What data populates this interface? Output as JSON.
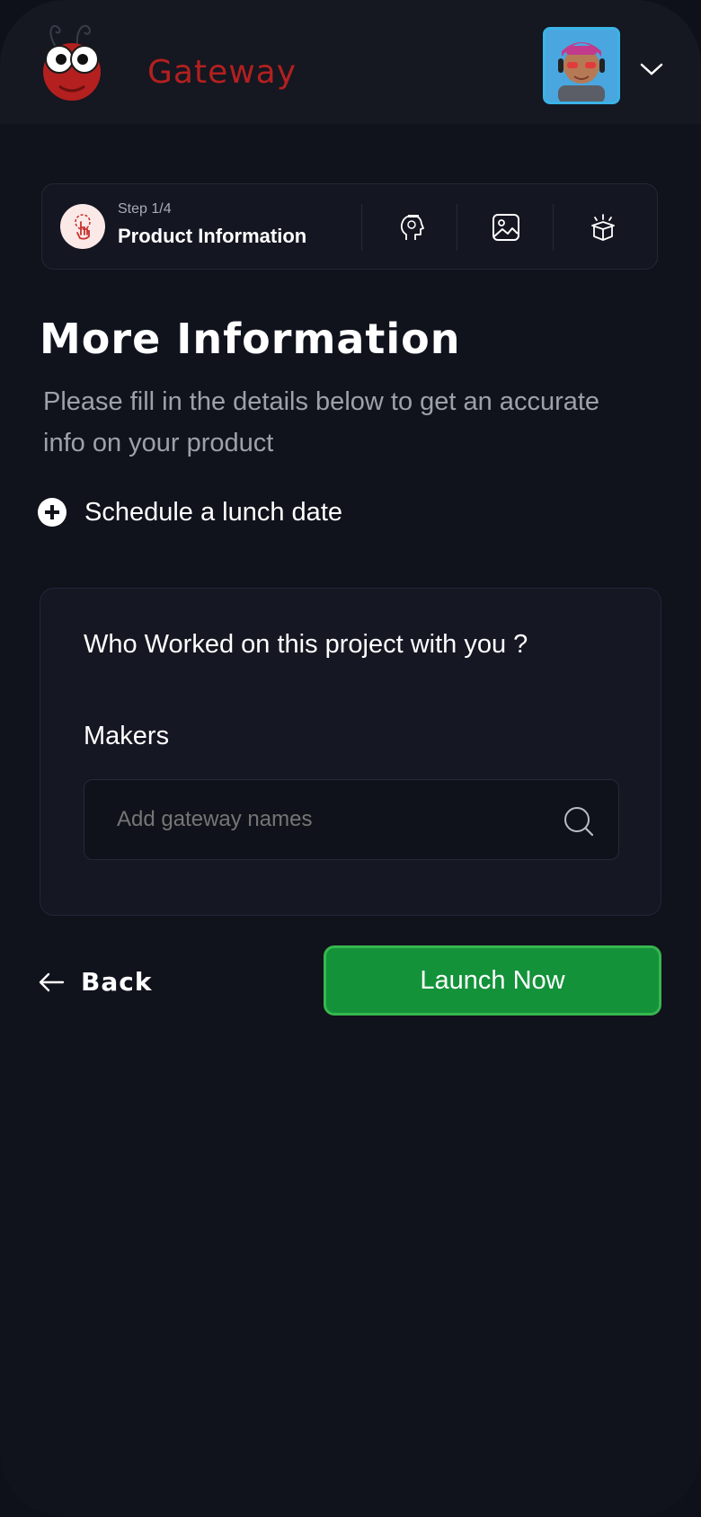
{
  "brand": {
    "name": "Gateway",
    "color": "#b3201f"
  },
  "stepper": {
    "step_label": "Step 1/4",
    "current_title": "Product Information",
    "icons": [
      "touch-icon",
      "mind-icon",
      "image-icon",
      "package-icon"
    ]
  },
  "main": {
    "title": "More Information",
    "subtitle": "Please fill in the details below to get an accurate info on your product",
    "schedule_label": "Schedule a lunch date"
  },
  "card": {
    "question": "Who Worked on this project with you  ?",
    "makers_label": "Makers",
    "input_value": "",
    "input_placeholder": "Add gateway names"
  },
  "actions": {
    "back_label": "Back",
    "launch_label": "Launch Now",
    "launch_color": "#13923a"
  }
}
